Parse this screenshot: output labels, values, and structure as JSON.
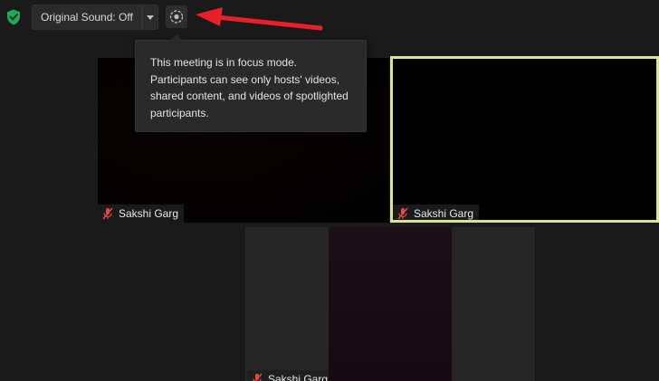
{
  "toolbar": {
    "security_icon": "shield-check-icon",
    "original_sound_label": "Original Sound: Off",
    "dropdown_icon": "caret-down-icon",
    "focus_mode_icon": "focus-mode-icon"
  },
  "tooltip": {
    "text": "This meeting is in focus mode. Participants can see only hosts' videos, shared content, and videos of spotlighted participants."
  },
  "annotation": {
    "arrow_color": "#e8202a"
  },
  "video_tiles": [
    {
      "name": "Sakshi Garg",
      "muted": true,
      "speaking": false
    },
    {
      "name": "Sakshi Garg",
      "muted": true,
      "speaking": true,
      "highlight_color": "#d9e39a"
    },
    {
      "name": "Sakshi Garg",
      "muted": true,
      "speaking": false
    }
  ]
}
